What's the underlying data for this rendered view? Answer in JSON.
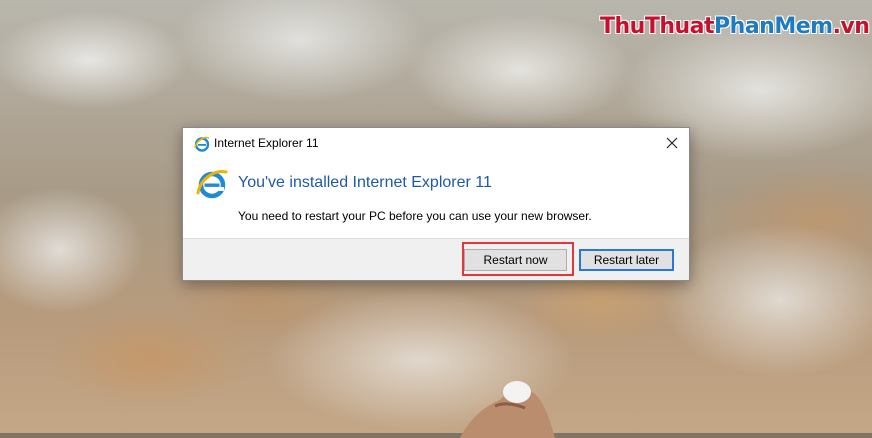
{
  "watermark": {
    "part1": "ThuThuat",
    "part2": "PhanMem",
    "part3": ".vn"
  },
  "dialog": {
    "title": "Internet Explorer 11",
    "heading": "You've installed Internet Explorer 11",
    "message": "You need to restart your PC before you can use your new browser.",
    "close_glyph": "✕",
    "buttons": {
      "restart_now": "Restart now",
      "restart_later": "Restart later"
    },
    "icon": "internet-explorer-icon"
  },
  "colors": {
    "heading": "#1e5aa8",
    "default_button_border": "#2a78d6",
    "highlight_box": "#e0383c",
    "logo_red": "#c8102e",
    "logo_blue": "#1f7bbf"
  }
}
